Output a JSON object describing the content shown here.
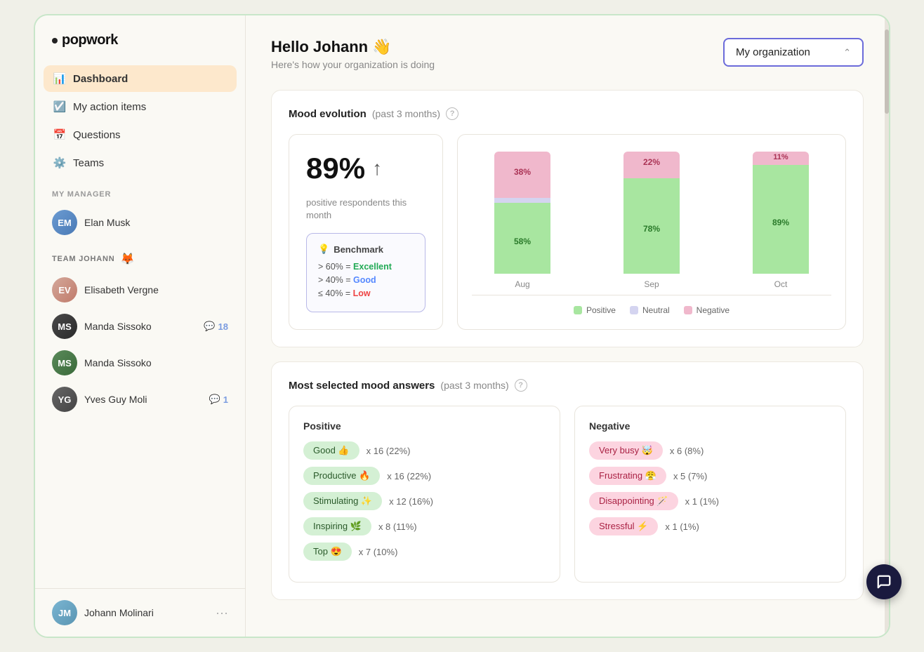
{
  "app": {
    "logo": "popwork",
    "logo_dot": "•"
  },
  "sidebar": {
    "nav_items": [
      {
        "id": "dashboard",
        "label": "Dashboard",
        "icon": "📊",
        "active": true
      },
      {
        "id": "action-items",
        "label": "My action items",
        "icon": "☑️",
        "active": false
      },
      {
        "id": "questions",
        "label": "Questions",
        "icon": "📅",
        "active": false
      },
      {
        "id": "teams",
        "label": "Teams",
        "icon": "⚙️",
        "active": false
      }
    ],
    "my_manager_label": "MY MANAGER",
    "manager": {
      "name": "Elan Musk",
      "initials": "EM"
    },
    "team_label": "TEAM JOHANN",
    "team_emoji": "🦊",
    "team_members": [
      {
        "name": "Elisabeth Vergne",
        "initials": "EV",
        "comments": null,
        "color": "#c07a6a"
      },
      {
        "name": "Manda Sissoko",
        "initials": "MS",
        "comments": 18,
        "color": "#3a3a3a"
      },
      {
        "name": "Manda Sissoko",
        "initials": "MS",
        "comments": null,
        "color": "#5a7a5a"
      },
      {
        "name": "Yves Guy Moli",
        "initials": "YG",
        "comments": 1,
        "color": "#555"
      }
    ],
    "current_user": {
      "name": "Johann Molinari",
      "initials": "JM",
      "color": "#5a95b2"
    }
  },
  "header": {
    "greeting": "Hello Johann 👋",
    "subtitle": "Here's how your organization is doing",
    "org_selector": "My organization"
  },
  "mood_evolution": {
    "title": "Mood evolution",
    "subtitle": "(past 3 months)",
    "percentage": "89%",
    "trend": "↑",
    "stat_description": "positive respondents this month",
    "benchmark_title": "Benchmark",
    "benchmark_emoji": "💡",
    "benchmark_rows": [
      {
        "condition": "> 60%",
        "equals": "Excellent",
        "class": "excellent"
      },
      {
        "condition": "> 40%",
        "equals": "Good",
        "class": "good"
      },
      {
        "condition": "≤ 40%",
        "equals": "Low",
        "class": "low"
      }
    ],
    "chart": {
      "months": [
        "Aug",
        "Sep",
        "Oct"
      ],
      "bars": [
        {
          "month": "Aug",
          "positive": 58,
          "neutral": 4,
          "negative": 38
        },
        {
          "month": "Sep",
          "positive": 78,
          "neutral": 0,
          "negative": 22
        },
        {
          "month": "Oct",
          "positive": 89,
          "neutral": 0,
          "negative": 11
        }
      ],
      "legend": [
        {
          "label": "Positive",
          "color": "#a8e6a0"
        },
        {
          "label": "Neutral",
          "color": "#d4d4f0"
        },
        {
          "label": "Negative",
          "color": "#f0b8cc"
        }
      ]
    }
  },
  "mood_answers": {
    "title": "Most selected mood answers",
    "subtitle": "(past 3 months)",
    "positive_col": {
      "title": "Positive",
      "items": [
        {
          "label": "Good 👍",
          "count": "x 16 (22%)"
        },
        {
          "label": "Productive 🔥",
          "count": "x 16 (22%)"
        },
        {
          "label": "Stimulating ✨",
          "count": "x 12 (16%)"
        },
        {
          "label": "Inspiring 🌿",
          "count": "x 8 (11%)"
        },
        {
          "label": "Top 😍",
          "count": "x 7 (10%)"
        }
      ]
    },
    "negative_col": {
      "title": "Negative",
      "items": [
        {
          "label": "Very busy 🤯",
          "count": "x 6 (8%)"
        },
        {
          "label": "Frustrating 😤",
          "count": "x 5 (7%)"
        },
        {
          "label": "Disappointing 🪄",
          "count": "x 1 (1%)"
        },
        {
          "label": "Stressful ⚡",
          "count": "x 1 (1%)"
        }
      ]
    }
  }
}
